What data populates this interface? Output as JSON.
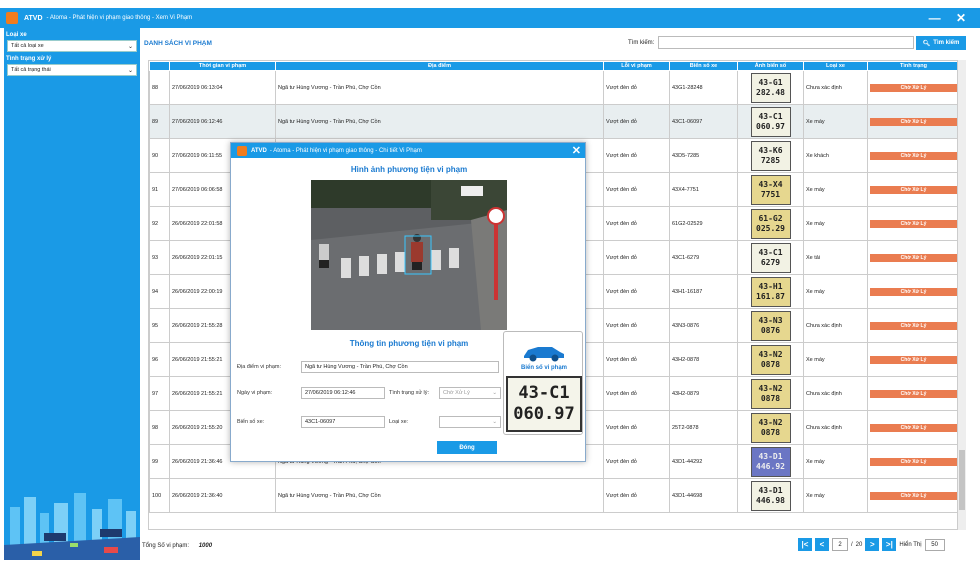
{
  "window": {
    "app_name": "ATVD",
    "title": "- Atoma - Phát hiện vi phạm giao thông - Xem Vi Phạm",
    "controls": "— ✕"
  },
  "sidebar": {
    "vehicle_type_label": "Loại xe",
    "vehicle_type_value": "Tất cả loại xe",
    "status_label": "Tình trạng xử lý",
    "status_value": "Tất cả trạng thái"
  },
  "header": {
    "list_title": "DANH SÁCH VI PHẠM",
    "search_label": "Tìm kiếm:",
    "search_placeholder": "",
    "search_button": "Tìm kiếm"
  },
  "table": {
    "columns": [
      "",
      "Thời gian vi phạm",
      "Địa điểm",
      "Lỗi vi phạm",
      "Biển số xe",
      "Ảnh biển số",
      "Loại xe",
      "Tình trạng"
    ],
    "rows": [
      {
        "no": "88",
        "time": "27/06/2019 06:13:04",
        "location": "Ngã tư Hùng Vương - Trần Phú, Chợ Cồn",
        "violation": "Vượt đèn đỏ",
        "plate": "43G1-28248",
        "plate_img": [
          "43-G1",
          "282.48"
        ],
        "vehicle": "Chưa xác định",
        "status": "Chờ Xử Lý",
        "img_style": "plain"
      },
      {
        "no": "89",
        "time": "27/06/2019 06:12:46",
        "location": "Ngã tư Hùng Vương - Trần Phú, Chợ Cồn",
        "violation": "Vượt đèn đỏ",
        "plate": "43C1-06097",
        "plate_img": [
          "43-C1",
          "060.97"
        ],
        "vehicle": "Xe máy",
        "status": "Chờ Xử Lý",
        "img_style": "plain"
      },
      {
        "no": "90",
        "time": "27/06/2019 06:11:55",
        "location": "",
        "violation": "Vượt đèn đỏ",
        "plate": "43D5-7285",
        "plate_img": [
          "43-K6",
          "7285"
        ],
        "vehicle": "Xe khách",
        "status": "Chờ Xử Lý",
        "img_style": "plain"
      },
      {
        "no": "91",
        "time": "27/06/2019 06:06:58",
        "location": "",
        "violation": "Vượt đèn đỏ",
        "plate": "43X4-7751",
        "plate_img": [
          "43-X4",
          "7751"
        ],
        "vehicle": "Xe máy",
        "status": "Chờ Xử Lý",
        "img_style": "gold"
      },
      {
        "no": "92",
        "time": "26/06/2019 22:01:58",
        "location": "",
        "violation": "Vượt đèn đỏ",
        "plate": "61G2-02529",
        "plate_img": [
          "61-G2",
          "025.29"
        ],
        "vehicle": "Xe máy",
        "status": "Chờ Xử Lý",
        "img_style": "gold"
      },
      {
        "no": "93",
        "time": "26/06/2019 22:01:15",
        "location": "",
        "violation": "Vượt đèn đỏ",
        "plate": "43C1-6279",
        "plate_img": [
          "43-C1",
          "6279"
        ],
        "vehicle": "Xe tải",
        "status": "Chờ Xử Lý",
        "img_style": "plain"
      },
      {
        "no": "94",
        "time": "26/06/2019 22:00:19",
        "location": "",
        "violation": "Vượt đèn đỏ",
        "plate": "43H1-16187",
        "plate_img": [
          "43-H1",
          "161.87"
        ],
        "vehicle": "Xe máy",
        "status": "Chờ Xử Lý",
        "img_style": "gold"
      },
      {
        "no": "95",
        "time": "26/06/2019 21:55:28",
        "location": "",
        "violation": "Vượt đèn đỏ",
        "plate": "43N3-0876",
        "plate_img": [
          "43-N3",
          "0876"
        ],
        "vehicle": "Chưa xác định",
        "status": "Chờ Xử Lý",
        "img_style": "gold"
      },
      {
        "no": "96",
        "time": "26/06/2019 21:55:21",
        "location": "",
        "violation": "Vượt đèn đỏ",
        "plate": "43H2-0878",
        "plate_img": [
          "43-N2",
          "0878"
        ],
        "vehicle": "Xe máy",
        "status": "Chờ Xử Lý",
        "img_style": "gold"
      },
      {
        "no": "97",
        "time": "26/06/2019 21:55:21",
        "location": "",
        "violation": "Vượt đèn đỏ",
        "plate": "43H2-0879",
        "plate_img": [
          "43-N2",
          "0878"
        ],
        "vehicle": "Chưa xác định",
        "status": "Chờ Xử Lý",
        "img_style": "gold"
      },
      {
        "no": "98",
        "time": "26/06/2019 21:55:20",
        "location": "",
        "violation": "Vượt đèn đỏ",
        "plate": "25T2-0878",
        "plate_img": [
          "43-N2",
          "0878"
        ],
        "vehicle": "Chưa xác định",
        "status": "Chờ Xử Lý",
        "img_style": "gold"
      },
      {
        "no": "99",
        "time": "26/06/2019 21:36:46",
        "location": "Ngã tư Hùng Vương - Trần Phú, Chợ Cồn",
        "violation": "Vượt đèn đỏ",
        "plate": "43D1-44292",
        "plate_img": [
          "43-D1",
          "446.92"
        ],
        "vehicle": "Xe máy",
        "status": "Chờ Xử Lý",
        "img_style": "blue"
      },
      {
        "no": "100",
        "time": "26/06/2019 21:36:40",
        "location": "Ngã tư Hùng Vương - Trần Phú, Chợ Cồn",
        "violation": "Vượt đèn đỏ",
        "plate": "43D1-44698",
        "plate_img": [
          "43-D1",
          "446.98"
        ],
        "vehicle": "Xe máy",
        "status": "Chờ Xử Lý",
        "img_style": "plain"
      }
    ]
  },
  "footer": {
    "total_label": "Tổng Số vi phạm:",
    "total_value": "1000",
    "page": "2",
    "page_sep": "/",
    "total_pages": "20",
    "per_page_label": "Hiển Thị",
    "per_page": "50"
  },
  "modal": {
    "app_name": "ATVD",
    "title": "- Atoma - Phát hiện vi phạm giao thông - Chi tiết Vi Phạm",
    "image_heading": "Hình ảnh phương tiện vi phạm",
    "info_heading": "Thông tin phương tiện vi phạm",
    "location_label": "Địa điểm vi phạm:",
    "location_value": "Ngã tư Hùng Vương - Trần Phú, Chợ Cồn",
    "date_label": "Ngày vi phạm:",
    "date_value": "27/06/2019 06:12:46",
    "status_label": "Tình trạng xử lý:",
    "status_value": "Chờ Xử Lý",
    "plate_label": "Biển số xe:",
    "plate_value": "43C1-06097",
    "vehicle_label": "Loại xe:",
    "vehicle_value": "",
    "plate_card_label": "Biển số vi phạm",
    "plate_card_lines": [
      "43-C1",
      "060.97"
    ],
    "close_button": "Đóng"
  },
  "colors": {
    "accent": "#1a9ae6",
    "status_pending": "#ea7c50"
  }
}
